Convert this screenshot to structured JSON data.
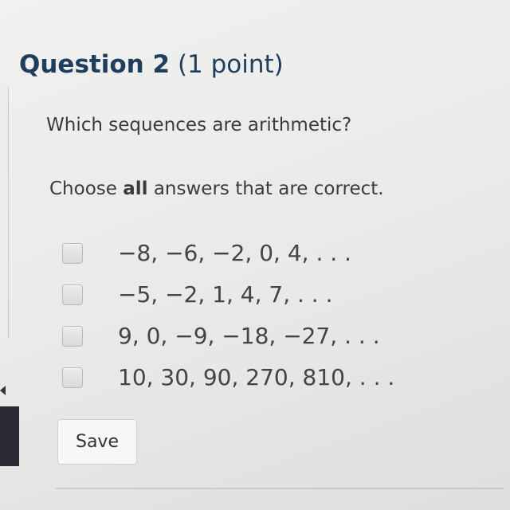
{
  "question": {
    "number_label": "Question 2",
    "points_label": "(1 point)",
    "prompt": "Which sequences are arithmetic?",
    "instructions": {
      "prefix": "Choose ",
      "emphasis": "all",
      "suffix": " answers that are correct."
    },
    "options": [
      {
        "label": "−8, −6, −2, 0, 4, . . .",
        "checked": false
      },
      {
        "label": "−5, −2, 1, 4, 7, . . .",
        "checked": false
      },
      {
        "label": "9, 0, −9, −18, −27, . . .",
        "checked": false
      },
      {
        "label": "10, 30, 90, 270, 810, . . .",
        "checked": false
      }
    ]
  },
  "actions": {
    "save_label": "Save"
  },
  "colors": {
    "title": "#1f3d5c",
    "text": "#3b3b3b",
    "checkbox": "#d9d9d9",
    "background": "#f2f2f0"
  }
}
